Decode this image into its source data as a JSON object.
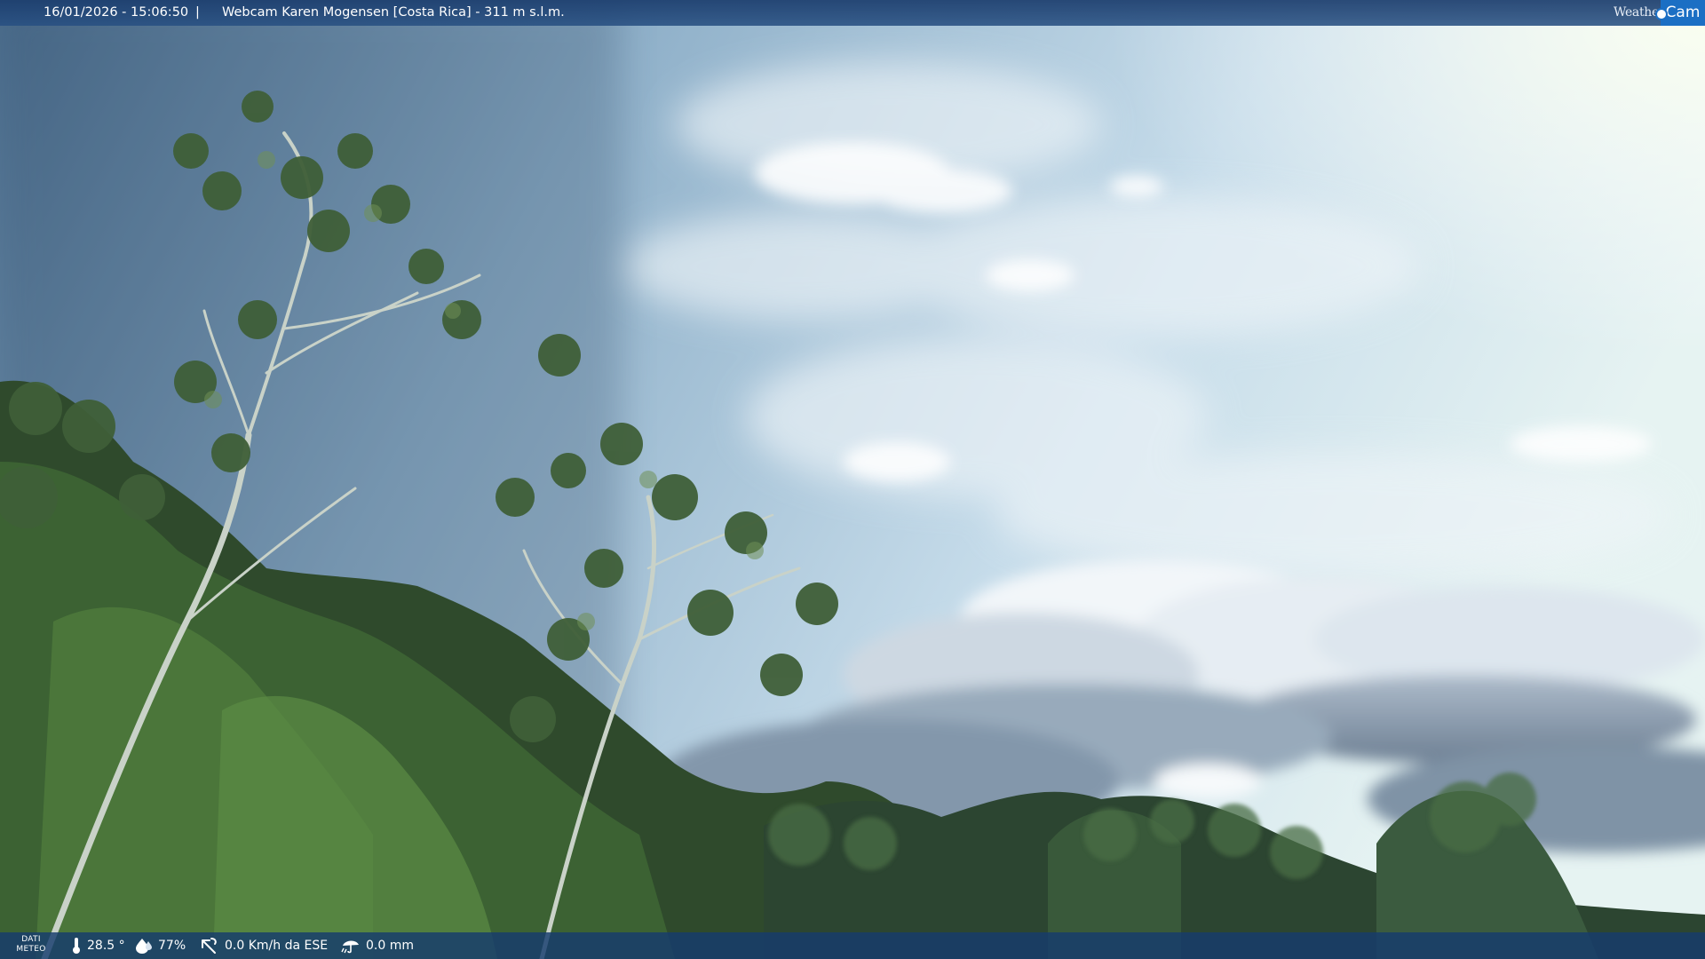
{
  "overlay": {
    "datetime": "16/01/2026 - 15:06:50",
    "separator": "|",
    "title": "Webcam Karen Mogensen [Costa Rica] - 311 m s.l.m.",
    "brand_weather": "Weather",
    "brand_cam": "Cam"
  },
  "meteo": {
    "label_line1": "DATI",
    "label_line2": "METEO",
    "temperature": "28.5 °",
    "humidity": "77%",
    "wind": "0.0 Km/h da ESE",
    "rain": "0.0 mm"
  },
  "colors": {
    "bar": "#1c3e6e",
    "brand": "#1b6fc4"
  },
  "icons": [
    "thermometer-icon",
    "humidity-drop-icon",
    "wind-icon",
    "rain-icon"
  ]
}
